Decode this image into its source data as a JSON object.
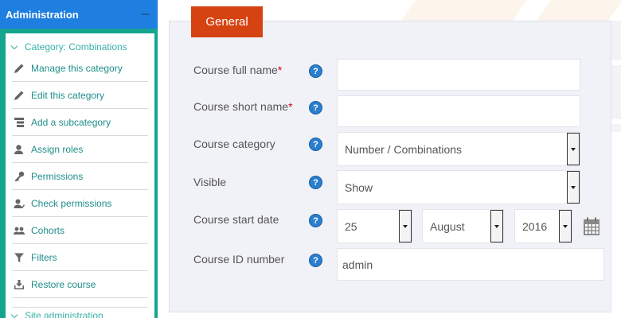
{
  "sidebar": {
    "title": "Administration",
    "category": "Category: Combinations",
    "items": [
      {
        "label": "Manage this category",
        "icon": "pencil-icon"
      },
      {
        "label": "Edit this category",
        "icon": "pencil-icon"
      },
      {
        "label": "Add a subcategory",
        "icon": "list-icon"
      },
      {
        "label": "Assign roles",
        "icon": "user-icon"
      },
      {
        "label": "Permissions",
        "icon": "key-icon"
      },
      {
        "label": "Check permissions",
        "icon": "user-check-icon"
      },
      {
        "label": "Cohorts",
        "icon": "users-icon"
      },
      {
        "label": "Filters",
        "icon": "filter-icon"
      },
      {
        "label": "Restore course",
        "icon": "download-icon"
      }
    ],
    "site_admin": "Site administration"
  },
  "form": {
    "tab": "General",
    "required_marker": "*",
    "help_glyph": "?",
    "full_name": {
      "label": "Course full name",
      "value": ""
    },
    "short_name": {
      "label": "Course short name",
      "value": ""
    },
    "category": {
      "label": "Course category",
      "value": "Number / Combinations"
    },
    "visible": {
      "label": "Visible",
      "value": "Show"
    },
    "start_date": {
      "label": "Course start date",
      "day": "25",
      "month": "August",
      "year": "2016"
    },
    "id_number": {
      "label": "Course ID number",
      "value": "admin"
    }
  },
  "colors": {
    "sidebar_header": "#1f7fe0",
    "sidebar_frame": "#14a58f",
    "tab_accent": "#d64312",
    "link": "#1e8e8a",
    "help": "#2a7fcf"
  }
}
